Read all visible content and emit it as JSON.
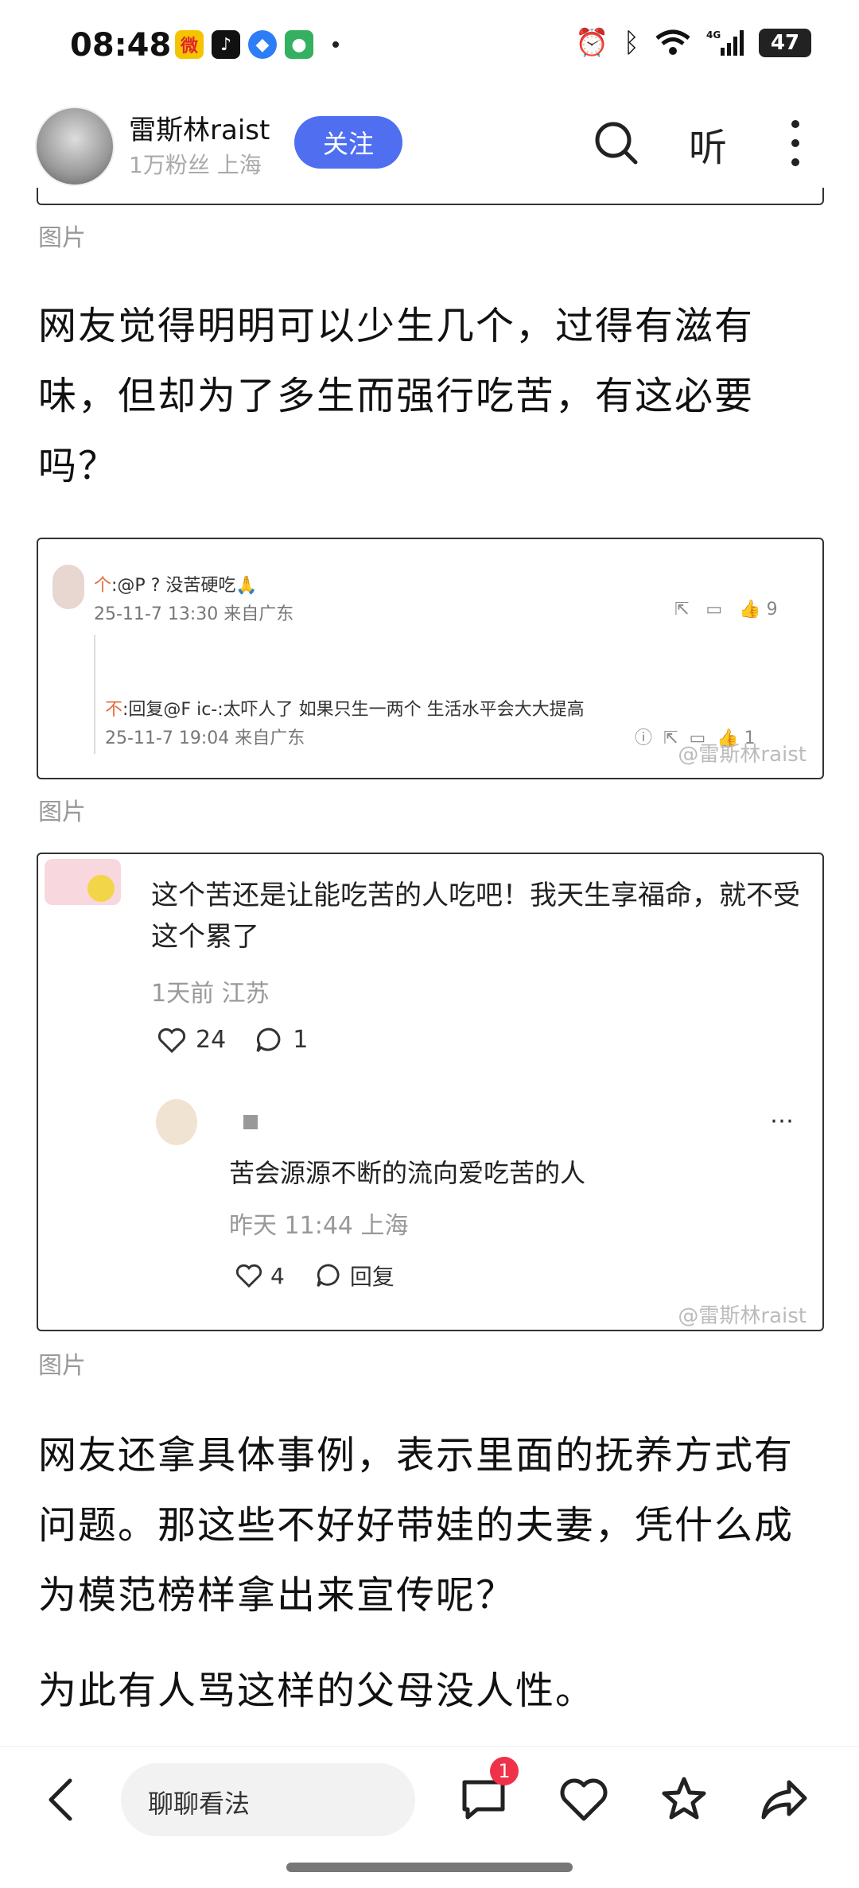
{
  "status_bar": {
    "time": "08:48",
    "network": "4G",
    "battery": "47",
    "app_icons": [
      "weibo-icon",
      "douyin-icon",
      "blue-app-icon",
      "green-app-icon"
    ]
  },
  "header": {
    "username": "雷斯林raist",
    "followers": "1万粉丝",
    "location": "上海",
    "follow_label": "关注",
    "listen_label": "听"
  },
  "content": {
    "image_label": "图片",
    "paragraph_1": "网友觉得明明可以少生几个，过得有滋有味，但却为了多生而强行吃苦，有这必要吗？",
    "screenshot_1": {
      "comment_1": {
        "user": "个",
        "text": ":@P  ? 没苦硬吃🙏",
        "meta": "25-11-7 13:30 来自广东",
        "likes": "9"
      },
      "comment_2": {
        "user": "不",
        "text": ":回复@F  ic-:太吓人了 如果只生一两个 生活水平会大大提高",
        "meta": "25-11-7 19:04 来自广东",
        "likes": "1"
      },
      "watermark": "@雷斯林raist"
    },
    "screenshot_2": {
      "comment_1": {
        "text": "这个苦还是让能吃苦的人吃吧！我天生享福命，就不受这个累了",
        "meta": "1天前 江苏",
        "likes": "24",
        "replies": "1"
      },
      "reply": {
        "text": "苦会源源不断的流向爱吃苦的人",
        "meta": "昨天 11:44 上海",
        "likes": "4",
        "reply_label": "回复"
      },
      "watermark": "@雷斯林raist"
    },
    "paragraph_2": "网友还拿具体事例，表示里面的抚养方式有问题。那这些不好好带娃的夫妻，凭什么成为模范榜样拿出来宣传呢？",
    "paragraph_3": "为此有人骂这样的父母没人性。"
  },
  "bottom_bar": {
    "input_placeholder": "聊聊看法",
    "comment_badge": "1"
  },
  "colors": {
    "accent": "#4f6ff0",
    "badge": "#f0314a"
  }
}
